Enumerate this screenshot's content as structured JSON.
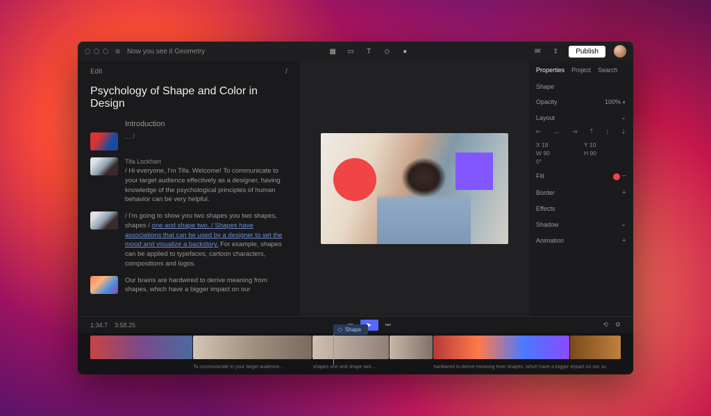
{
  "titlebar": {
    "project_name": "Now you see it Geometry",
    "publish_label": "Publish"
  },
  "script": {
    "edit_label": "Edit",
    "slash": "/",
    "title": "Psychology of Shape and Color in Design",
    "intro_label": "Introduction",
    "ellipsis": "... /",
    "speaker": "Tifa Lockhart",
    "para1": "/ Hi everyone, I'm Tifa. Welcome! To communicate to your target audience effectively as a designer, having knowledge of the psychological principles of human behavior can be very helpful.",
    "para2_a": "/ I'm going to show you two shapes you two shapes, shapes / ",
    "para2_link": "one and shape two. / Shapes have associations that can be used by a designer to set the mood and visualize a backstory.",
    "para2_b": " For example, shapes can be applied to typefaces, cartoon characters, compositions and logos.",
    "para3": "Our brains are hardwired to derive meaning from shapes, which have a bigger impact on our"
  },
  "properties": {
    "tabs": {
      "properties": "Properties",
      "project": "Project",
      "search": "Search"
    },
    "shape_label": "Shape",
    "opacity_label": "Opacity",
    "opacity_value": "100%",
    "layout_label": "Layout",
    "x_label": "X 18",
    "y_label": "Y 10",
    "w_label": "W 90",
    "h_label": "H 90",
    "rot_label": "0°",
    "fill_label": "Fill",
    "border_label": "Border",
    "effects_label": "Effects",
    "shadow_label": "Shadow",
    "animation_label": "Animation"
  },
  "transport": {
    "current_time": "1:34.7",
    "total_time": "3:58.25",
    "shape_chip": "Shape"
  },
  "captions": {
    "c2": "To communicate to your target audience…",
    "c3": "shapes one and shape two…",
    "c5": "hardwired to derive meaning from shapes, which have a bigger impact on our su"
  }
}
